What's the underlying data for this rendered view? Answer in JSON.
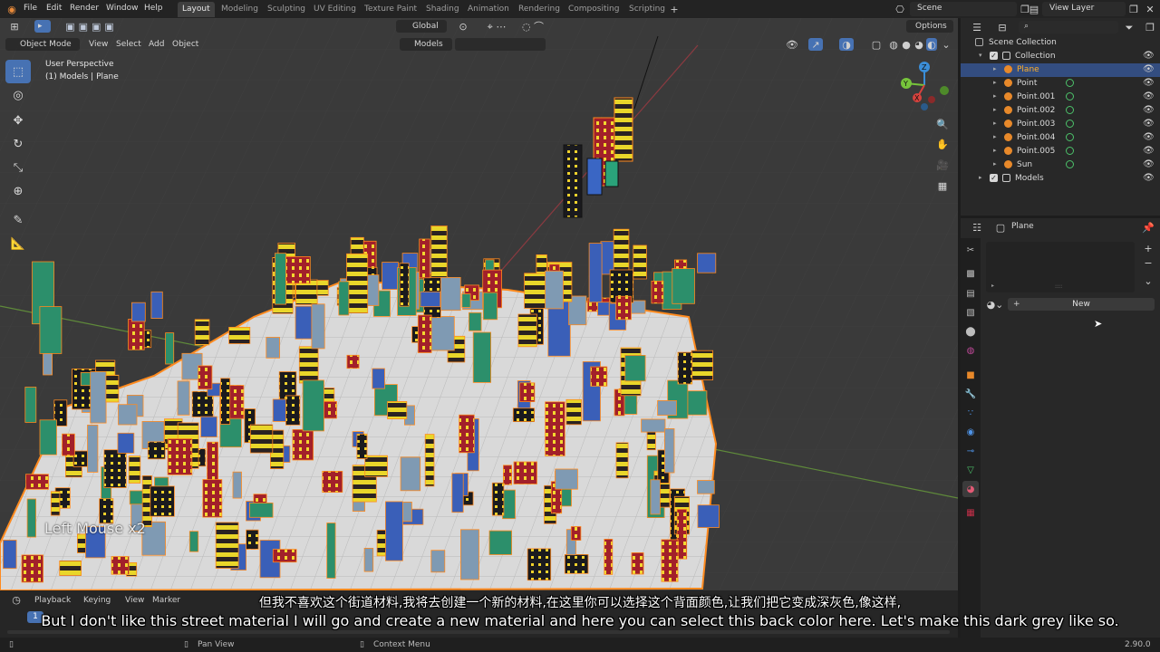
{
  "menu": [
    "File",
    "Edit",
    "Render",
    "Window",
    "Help"
  ],
  "workspaces": [
    {
      "label": "Layout",
      "active": true
    },
    {
      "label": "Modeling",
      "active": false
    },
    {
      "label": "Sculpting",
      "active": false
    },
    {
      "label": "UV Editing",
      "active": false
    },
    {
      "label": "Texture Paint",
      "active": false
    },
    {
      "label": "Shading",
      "active": false
    },
    {
      "label": "Animation",
      "active": false
    },
    {
      "label": "Rendering",
      "active": false
    },
    {
      "label": "Compositing",
      "active": false
    },
    {
      "label": "Scripting",
      "active": false
    }
  ],
  "scene_name": "Scene",
  "view_layer": "View Layer",
  "viewport_header": {
    "mode": "Object Mode",
    "menus": [
      "View",
      "Select",
      "Add",
      "Object"
    ],
    "transform_orientation": "Global",
    "collection_filter": "Models",
    "options": "Options"
  },
  "viewport": {
    "perspective": "User Perspective",
    "context": "(1) Models | Plane",
    "keycast": "Left Mouse x2"
  },
  "gizmo_axes": [
    "X",
    "Y",
    "Z"
  ],
  "outliner": {
    "root": "Scene Collection",
    "rows": [
      {
        "label": "Collection",
        "indent": 1
      },
      {
        "label": "Plane",
        "indent": 2,
        "selected": true
      },
      {
        "label": "Point",
        "indent": 2
      },
      {
        "label": "Point.001",
        "indent": 2
      },
      {
        "label": "Point.002",
        "indent": 2
      },
      {
        "label": "Point.003",
        "indent": 2
      },
      {
        "label": "Point.004",
        "indent": 2
      },
      {
        "label": "Point.005",
        "indent": 2
      },
      {
        "label": "Sun",
        "indent": 2
      },
      {
        "label": "Models",
        "indent": 1
      }
    ]
  },
  "properties": {
    "object_name": "Plane",
    "new_button": "New"
  },
  "timeline": {
    "menus": [
      "Playback",
      "Keying",
      "View",
      "Marker"
    ],
    "frame": "1"
  },
  "statusbar": {
    "pan": "Pan View",
    "context_menu": "Context Menu",
    "version": "2.90.0"
  },
  "subtitles": {
    "cn": "但我不喜欢这个街道材料,我将去创建一个新的材料,在这里你可以选择这个背面颜色,让我们把它变成深灰色,像这样,",
    "en": "But I don't like this street material I will go and create a new material and here you can select this back color here. Let's make this dark grey like so."
  },
  "colors": {
    "accent": "#4772b3",
    "selection_outline": "#ff8a1e",
    "building_yellow": "#f2dd2a",
    "building_red": "#a8242c",
    "axis_x": "#d8423d",
    "axis_y": "#76c43b",
    "axis_z": "#3b8ed8"
  }
}
